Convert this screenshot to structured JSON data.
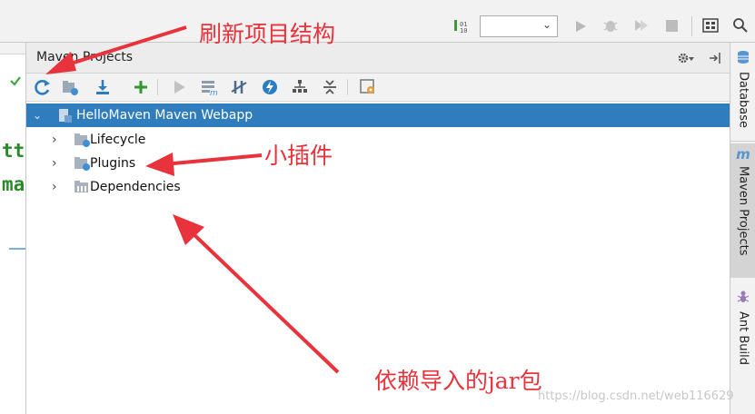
{
  "panel": {
    "title": "Maven Projects"
  },
  "toolbar_top": {
    "run_config_value": "",
    "icons": [
      "sort-icon",
      "run-config-dropdown",
      "run-icon",
      "debug-icon",
      "coverage-icon",
      "stop-icon",
      "structure-icon",
      "search-icon"
    ]
  },
  "maven_toolbar": {
    "icons": [
      "refresh-icon",
      "generate-sources-icon",
      "download-icon",
      "add-icon",
      "run-icon",
      "execute-goal-icon",
      "toggle-offline-icon",
      "skip-tests-icon",
      "show-dependencies-icon",
      "collapse-all-icon",
      "settings-icon"
    ]
  },
  "tree": {
    "root": "HelloMaven Maven Webapp",
    "children": [
      {
        "label": "Lifecycle"
      },
      {
        "label": "Plugins"
      },
      {
        "label": "Dependencies"
      }
    ]
  },
  "right_tabs": [
    {
      "label": "Database"
    },
    {
      "label": "Maven Projects"
    },
    {
      "label": "Ant Build"
    }
  ],
  "annotations": {
    "refresh": "刷新项目结构",
    "plugins": "小插件",
    "deps": "依赖导入的jar包"
  },
  "editor_snippet": [
    "tt",
    "ma"
  ],
  "watermark": "https://blog.csdn.net/web116629",
  "colors": {
    "selection": "#2f7dbd",
    "annotation_red": "#e8323c",
    "maven_blue": "#1e88c8"
  }
}
